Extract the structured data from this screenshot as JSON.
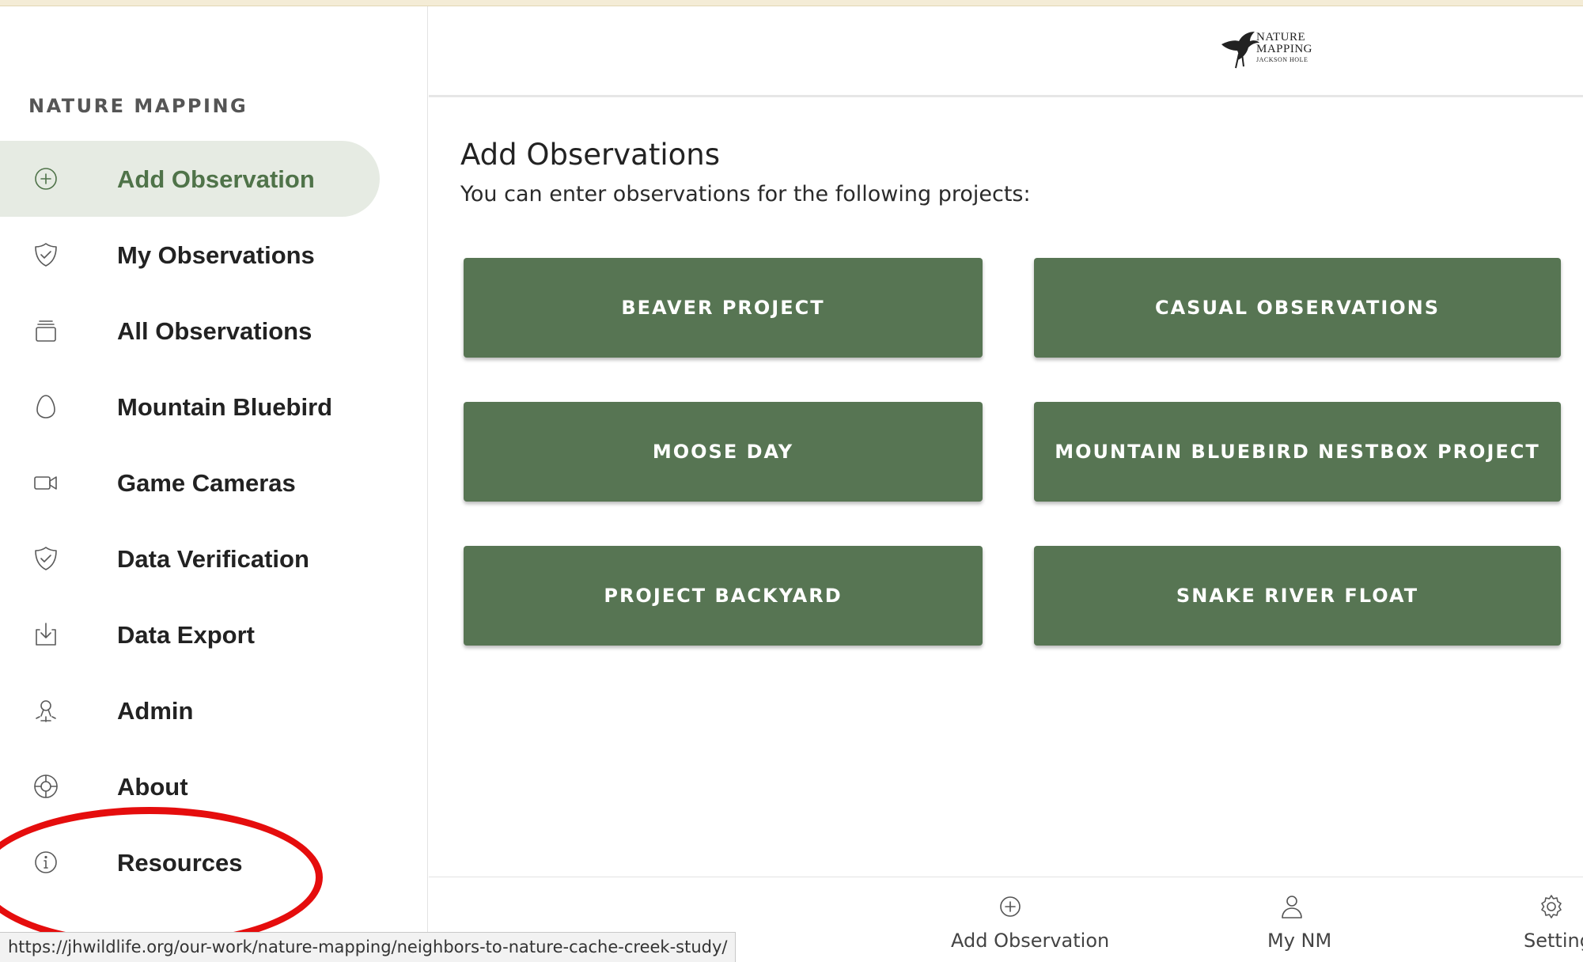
{
  "brand": {
    "logo_line1": "NATURE",
    "logo_line2": "MAPPING",
    "logo_line3": "JACKSON HOLE"
  },
  "sidebar": {
    "title": "NATURE MAPPING",
    "active_item": "Add Observation",
    "items": [
      {
        "label": "Add Observation",
        "icon": "add-circle-icon"
      },
      {
        "label": "My Observations",
        "icon": "shield-check-icon"
      },
      {
        "label": "All Observations",
        "icon": "stack-icon"
      },
      {
        "label": "Mountain Bluebird",
        "icon": "egg-icon"
      },
      {
        "label": "Game Cameras",
        "icon": "video-camera-icon"
      },
      {
        "label": "Data Verification",
        "icon": "shield-check-icon"
      },
      {
        "label": "Data Export",
        "icon": "download-icon"
      },
      {
        "label": "Admin",
        "icon": "admin-icon"
      },
      {
        "label": "About",
        "icon": "lifebuoy-icon"
      },
      {
        "label": "Resources",
        "icon": "info-icon"
      }
    ]
  },
  "main": {
    "title": "Add Observations",
    "subtitle": "You can enter observations for the following projects:",
    "projects": [
      "BEAVER PROJECT",
      "CASUAL OBSERVATIONS",
      "MOOSE DAY",
      "MOUNTAIN BLUEBIRD NESTBOX PROJECT",
      "PROJECT BACKYARD",
      "SNAKE RIVER FLOAT"
    ]
  },
  "bottom_nav": {
    "items": [
      {
        "label": "Add Observation",
        "icon": "add-circle-icon"
      },
      {
        "label": "My NM",
        "icon": "user-icon"
      },
      {
        "label": "Setting",
        "icon": "gear-icon"
      }
    ]
  },
  "status_bar": {
    "url": "https://jhwildlife.org/our-work/nature-mapping/neighbors-to-nature-cache-creek-study/"
  },
  "colors": {
    "accent": "#577553",
    "active_bg": "#e6ebe3",
    "annotation": "#e50d0d"
  }
}
